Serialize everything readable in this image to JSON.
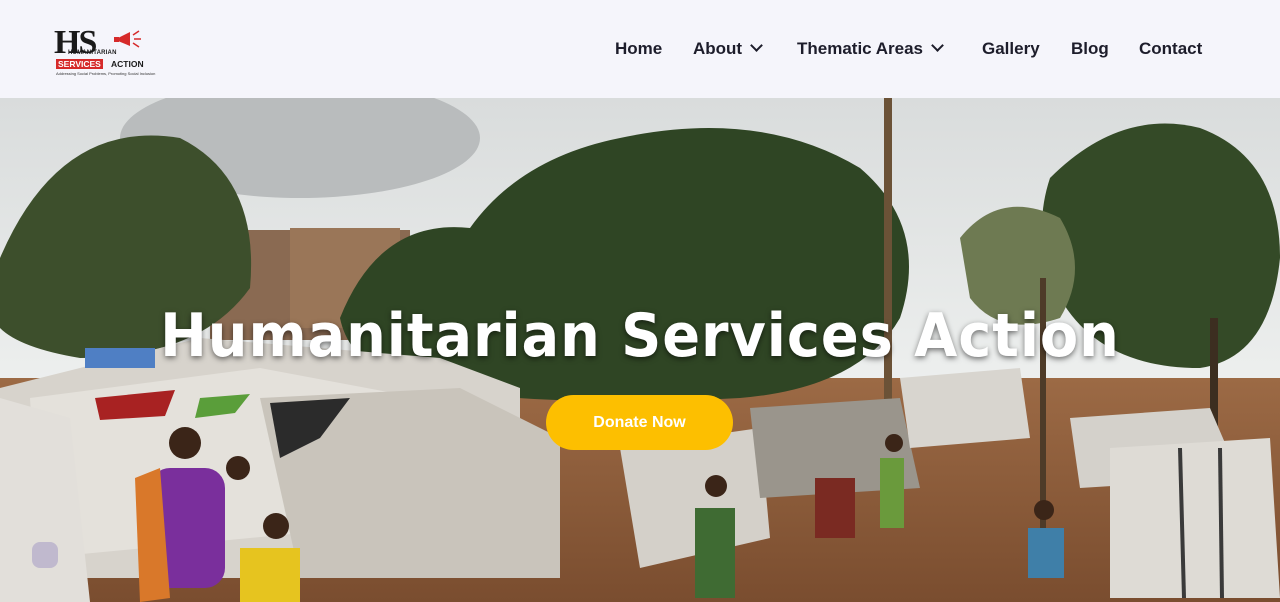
{
  "brand": {
    "logo_mark": "HS",
    "logo_line1": "HUMANITARIAN",
    "logo_line2a": "SERVICES",
    "logo_line2b": "ACTION",
    "logo_tagline": "Addressing Social Problems, Promoting Social Inclusion",
    "logo_icon": "megaphone-icon",
    "accent_red": "#d62a2a"
  },
  "nav": {
    "items": [
      {
        "label": "Home"
      },
      {
        "label": "About",
        "has_dropdown": true
      },
      {
        "label": "Thematic Areas",
        "has_dropdown": true
      },
      {
        "label": "Gallery"
      },
      {
        "label": "Blog"
      },
      {
        "label": "Contact"
      }
    ]
  },
  "hero": {
    "title": "Humanitarian Services Action",
    "cta_label": "Donate Now",
    "cta_color": "#fdbf00"
  }
}
